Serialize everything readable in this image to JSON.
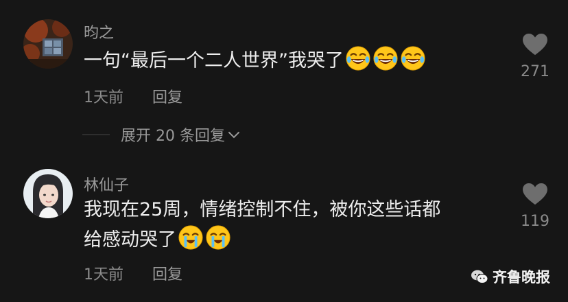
{
  "comments": [
    {
      "username": "昀之",
      "text": "一句“最后一个二人世界”我哭了",
      "emojis": [
        "rofl-emoji",
        "rofl-emoji",
        "rofl-emoji"
      ],
      "time": "1天前",
      "reply_label": "回复",
      "likes": "271"
    },
    {
      "username": "林仙子",
      "text_line1": "我现在25周，情绪控制不住，被你这些话都",
      "text_line2": "给感动哭了",
      "emojis": [
        "crying-emoji",
        "crying-emoji"
      ],
      "time": "1天前",
      "reply_label": "回复",
      "likes": "119"
    }
  ],
  "expand_replies": {
    "label": "展开 20 条回复"
  },
  "watermark": {
    "text": "齐鲁晚报",
    "icon": "wechat-icon"
  },
  "colors": {
    "background": "#161616",
    "text": "#ededed",
    "muted": "#8c8c8c"
  }
}
